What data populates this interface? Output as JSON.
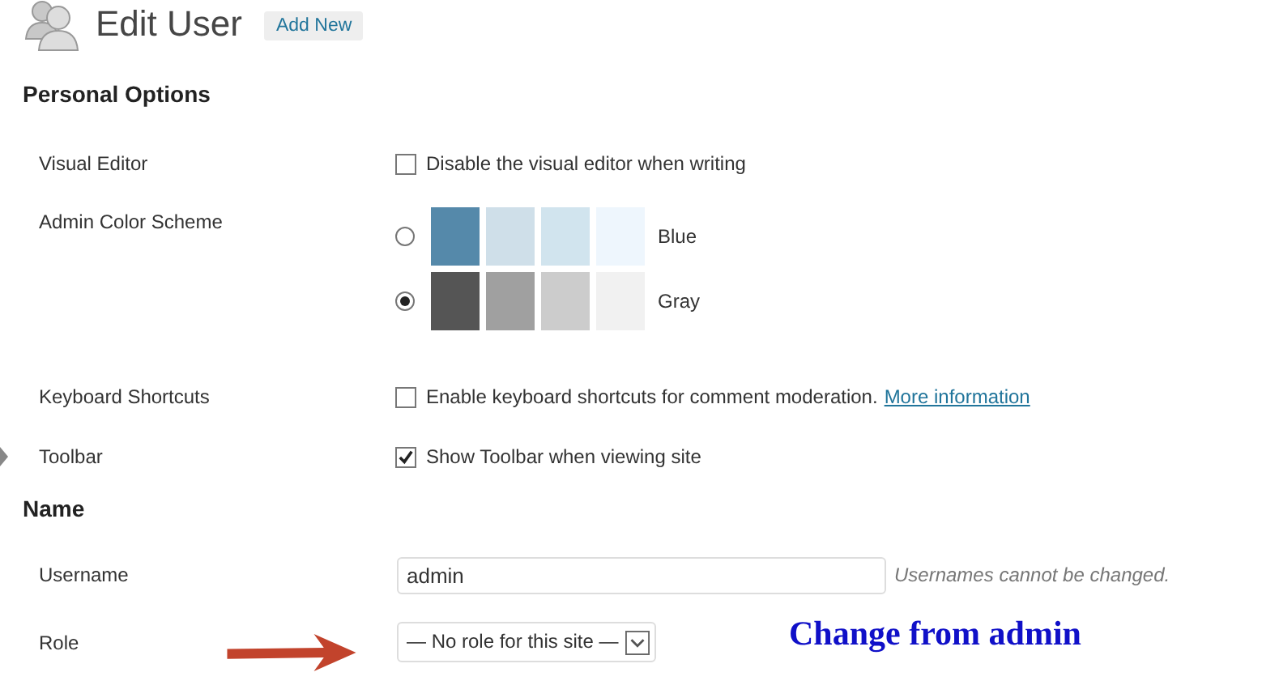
{
  "header": {
    "title": "Edit User",
    "add_new": "Add New"
  },
  "sections": [
    {
      "heading": "Personal Options",
      "rows": [
        {
          "kind": "checkbox",
          "label": "Visual Editor",
          "text": "Disable the visual editor when writing",
          "checked": false
        },
        {
          "kind": "color_scheme",
          "label": "Admin Color Scheme",
          "schemes": [
            {
              "name": "Blue",
              "selected": false,
              "swatches": [
                {
                  "color": "#5589aa"
                },
                {
                  "color": "#cfdfe9"
                },
                {
                  "color": "#d1e4ee"
                },
                {
                  "color": "#eef6fd"
                }
              ]
            },
            {
              "name": "Gray",
              "selected": true,
              "swatches": [
                {
                  "color": "#555555"
                },
                {
                  "color": "#a0a0a0"
                },
                {
                  "color": "#cccccc"
                },
                {
                  "color": "#f1f1f1"
                }
              ]
            }
          ]
        },
        {
          "kind": "checkbox",
          "label": "Keyboard Shortcuts",
          "text": "Enable keyboard shortcuts for comment moderation.",
          "link": "More information",
          "checked": false
        },
        {
          "kind": "checkbox",
          "label": "Toolbar",
          "text": "Show Toolbar when viewing site",
          "checked": true,
          "pointer": true
        }
      ]
    },
    {
      "heading": "Name",
      "rows": [
        {
          "kind": "text_field",
          "label": "Username",
          "value": "admin",
          "note": "Usernames cannot be changed."
        },
        {
          "kind": "select",
          "label": "Role",
          "value": "— No role for this site —",
          "arrow": true
        }
      ]
    }
  ],
  "annotation": {
    "text": "Change from admin"
  }
}
